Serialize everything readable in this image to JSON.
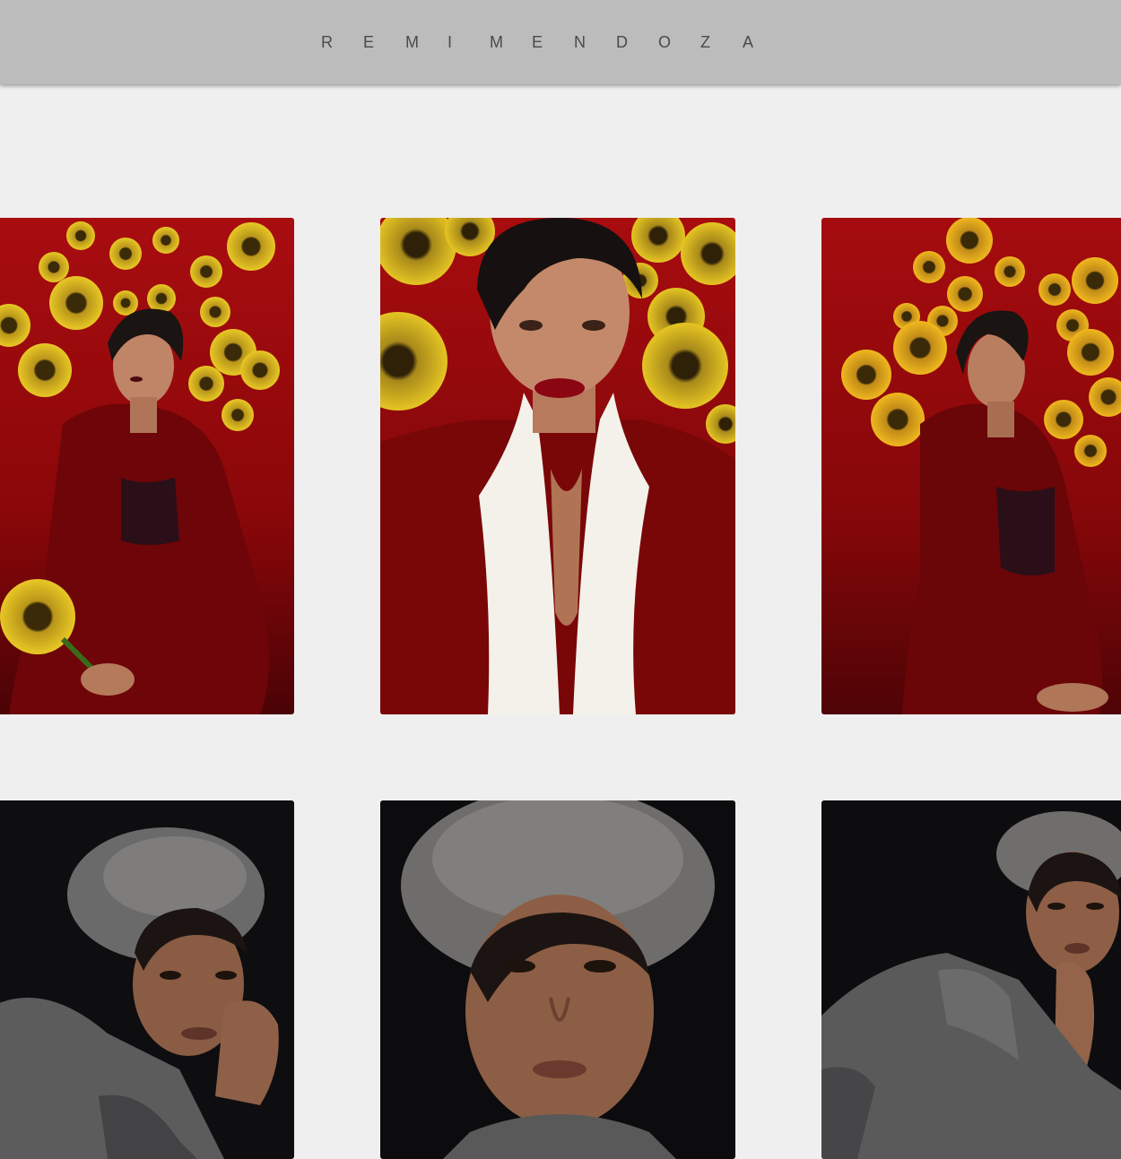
{
  "header": {
    "site_name": "REMI MENDOZA",
    "letters": [
      "R",
      "E",
      "M",
      "I",
      "M",
      "E",
      "N",
      "D",
      "O",
      "Z",
      "A"
    ]
  },
  "colors": {
    "header_bg": "#bcbcbc",
    "page_bg": "#efefef",
    "red_backdrop": "#9a0a0c",
    "dark_backdrop": "#0e0d0f",
    "sunflower": "#e3c21f"
  },
  "gallery": {
    "rows": [
      {
        "theme": "red-sunflower",
        "photos": [
          "photo-red-seated-sunflower",
          "photo-red-closeup-white-collar",
          "photo-red-profile-seated"
        ]
      },
      {
        "theme": "dark-beret",
        "photos": [
          "photo-beret-hand-on-chin",
          "photo-beret-closeup",
          "photo-beret-hand-to-lip"
        ]
      }
    ]
  }
}
